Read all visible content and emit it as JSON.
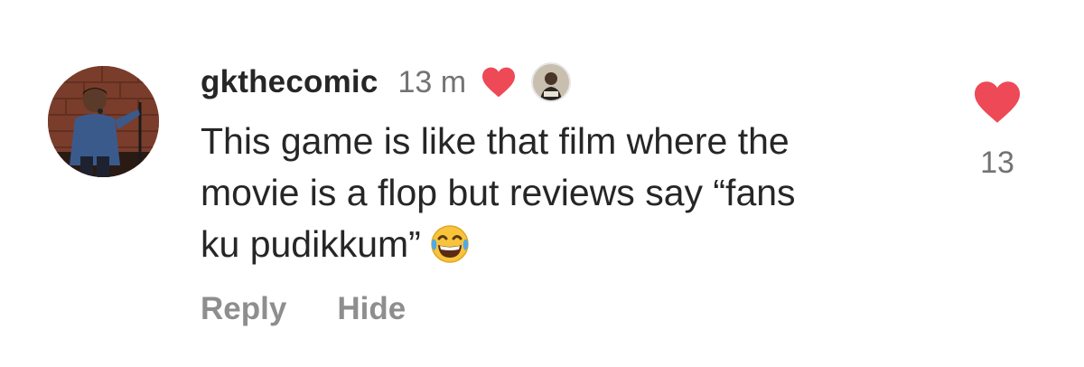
{
  "comment": {
    "username": "gkthecomic",
    "time": "13 m",
    "text_lines": [
      "This game is like that film where the",
      "movie is a flop but reviews say “fans",
      "ku pudikkum”"
    ],
    "emoji": "face-with-tears-of-joy",
    "creator_liked": true,
    "actions": {
      "reply_label": "Reply",
      "hide_label": "Hide"
    },
    "likes": {
      "count": "13",
      "liked": true
    }
  },
  "colors": {
    "heart": "#ed4956",
    "text": "#262626",
    "secondary": "#737373",
    "action": "#8e8e8e"
  },
  "icons": {
    "meta_heart": "heart-icon",
    "like_heart": "heart-icon",
    "emoji": "laughing-tears-emoji"
  }
}
